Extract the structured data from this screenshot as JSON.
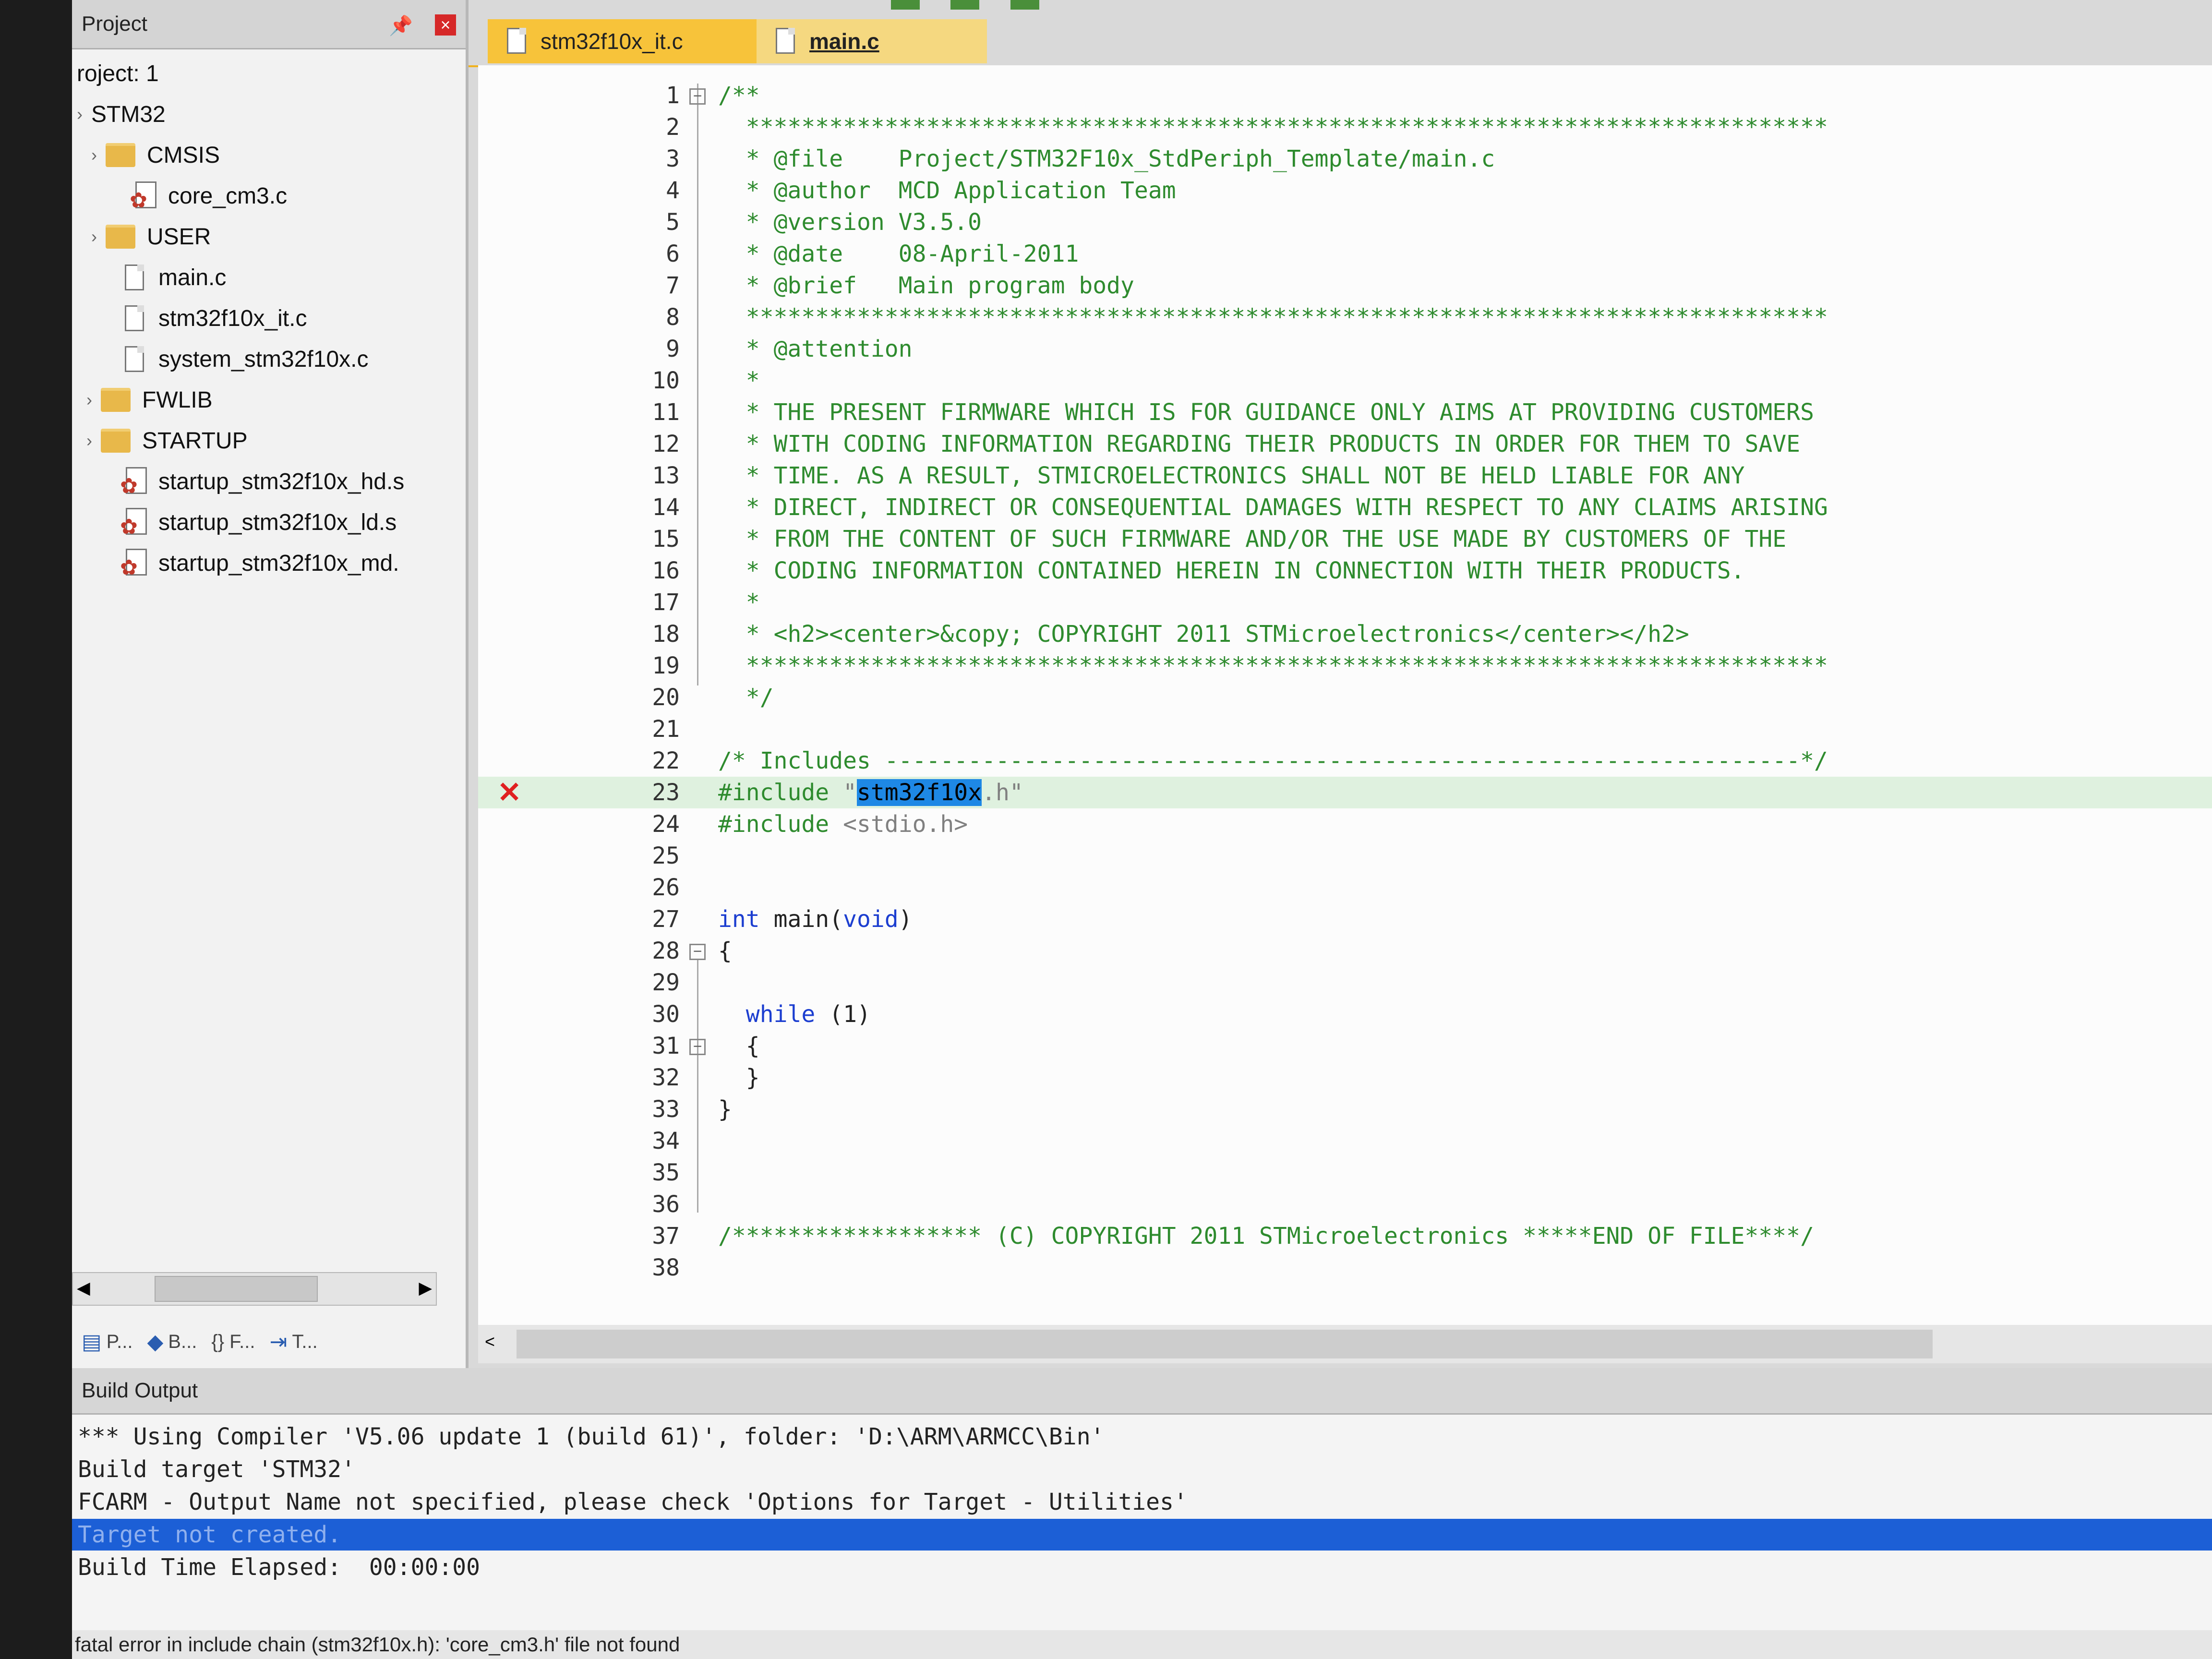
{
  "project_panel": {
    "title": "Project",
    "pin_icon": "pin-icon",
    "close_icon": "close-icon",
    "tree": [
      {
        "label": "roject: 1",
        "type": "root"
      },
      {
        "label": "STM32",
        "type": "target"
      },
      {
        "label": "CMSIS",
        "type": "folder"
      },
      {
        "label": "core_cm3.c",
        "type": "gear-file"
      },
      {
        "label": "USER",
        "type": "folder"
      },
      {
        "label": "main.c",
        "type": "file"
      },
      {
        "label": "stm32f10x_it.c",
        "type": "file"
      },
      {
        "label": "system_stm32f10x.c",
        "type": "file"
      },
      {
        "label": "FWLIB",
        "type": "folder"
      },
      {
        "label": "STARTUP",
        "type": "folder"
      },
      {
        "label": "startup_stm32f10x_hd.s",
        "type": "gear-file"
      },
      {
        "label": "startup_stm32f10x_ld.s",
        "type": "gear-file"
      },
      {
        "label": "startup_stm32f10x_md.",
        "type": "gear-file"
      }
    ],
    "tabs": [
      {
        "label": "P...",
        "icon": "project-icon"
      },
      {
        "label": "B...",
        "icon": "books-icon"
      },
      {
        "label": "{} F...",
        "icon": "functions-icon"
      },
      {
        "label": "T...",
        "icon": "templates-icon"
      }
    ]
  },
  "editor": {
    "tabs": [
      {
        "label": "stm32f10x_it.c",
        "active": false
      },
      {
        "label": "main.c",
        "active": true
      }
    ],
    "error_marker_line": 23,
    "lines": [
      {
        "n": "1",
        "text": "/**"
      },
      {
        "n": "2",
        "text": "  ******************************************************************************"
      },
      {
        "n": "3",
        "text": "  * @file    Project/STM32F10x_StdPeriph_Template/main.c"
      },
      {
        "n": "4",
        "text": "  * @author  MCD Application Team"
      },
      {
        "n": "5",
        "text": "  * @version V3.5.0"
      },
      {
        "n": "6",
        "text": "  * @date    08-April-2011"
      },
      {
        "n": "7",
        "text": "  * @brief   Main program body"
      },
      {
        "n": "8",
        "text": "  ******************************************************************************"
      },
      {
        "n": "9",
        "text": "  * @attention"
      },
      {
        "n": "10",
        "text": "  *"
      },
      {
        "n": "11",
        "text": "  * THE PRESENT FIRMWARE WHICH IS FOR GUIDANCE ONLY AIMS AT PROVIDING CUSTOMERS"
      },
      {
        "n": "12",
        "text": "  * WITH CODING INFORMATION REGARDING THEIR PRODUCTS IN ORDER FOR THEM TO SAVE"
      },
      {
        "n": "13",
        "text": "  * TIME. AS A RESULT, STMICROELECTRONICS SHALL NOT BE HELD LIABLE FOR ANY"
      },
      {
        "n": "14",
        "text": "  * DIRECT, INDIRECT OR CONSEQUENTIAL DAMAGES WITH RESPECT TO ANY CLAIMS ARISING"
      },
      {
        "n": "15",
        "text": "  * FROM THE CONTENT OF SUCH FIRMWARE AND/OR THE USE MADE BY CUSTOMERS OF THE"
      },
      {
        "n": "16",
        "text": "  * CODING INFORMATION CONTAINED HEREIN IN CONNECTION WITH THEIR PRODUCTS."
      },
      {
        "n": "17",
        "text": "  *"
      },
      {
        "n": "18",
        "text": "  * <h2><center>&copy; COPYRIGHT 2011 STMicroelectronics</center></h2>"
      },
      {
        "n": "19",
        "text": "  ******************************************************************************"
      },
      {
        "n": "20",
        "text": "  */"
      },
      {
        "n": "21",
        "text": ""
      },
      {
        "n": "22",
        "text": "/* Includes ------------------------------------------------------------------*/"
      },
      {
        "n": "23",
        "pre": "#include ",
        "q": "\"",
        "sel": "stm32f10x",
        "post": ".h\""
      },
      {
        "n": "24",
        "pre": "#include ",
        "str": "<stdio.h>"
      },
      {
        "n": "25",
        "text": ""
      },
      {
        "n": "26",
        "text": ""
      },
      {
        "n": "27",
        "kw1": "int",
        "mid": " main(",
        "kw2": "void",
        "end": ")"
      },
      {
        "n": "28",
        "text": "{"
      },
      {
        "n": "29",
        "text": ""
      },
      {
        "n": "30",
        "kw1": "  while",
        "end": " (1)"
      },
      {
        "n": "31",
        "text": "  {"
      },
      {
        "n": "32",
        "text": "  }"
      },
      {
        "n": "33",
        "text": "}"
      },
      {
        "n": "34",
        "text": ""
      },
      {
        "n": "35",
        "text": ""
      },
      {
        "n": "36",
        "text": ""
      },
      {
        "n": "37",
        "text": "/****************** (C) COPYRIGHT 2011 STMicroelectronics *****END OF FILE****/"
      },
      {
        "n": "38",
        "text": ""
      }
    ]
  },
  "build_output": {
    "title": "Build Output",
    "lines": [
      "*** Using Compiler 'V5.06 update 1 (build 61)', folder: 'D:\\ARM\\ARMCC\\Bin'",
      "Build target 'STM32'",
      "FCARM - Output Name not specified, please check 'Options for Target - Utilities'",
      "Target not created.",
      "Build Time Elapsed:  00:00:00"
    ],
    "selected_line": 3
  },
  "status_bar": {
    "text": "fatal error in include chain (stm32f10x.h): 'core_cm3.h' file not found"
  }
}
